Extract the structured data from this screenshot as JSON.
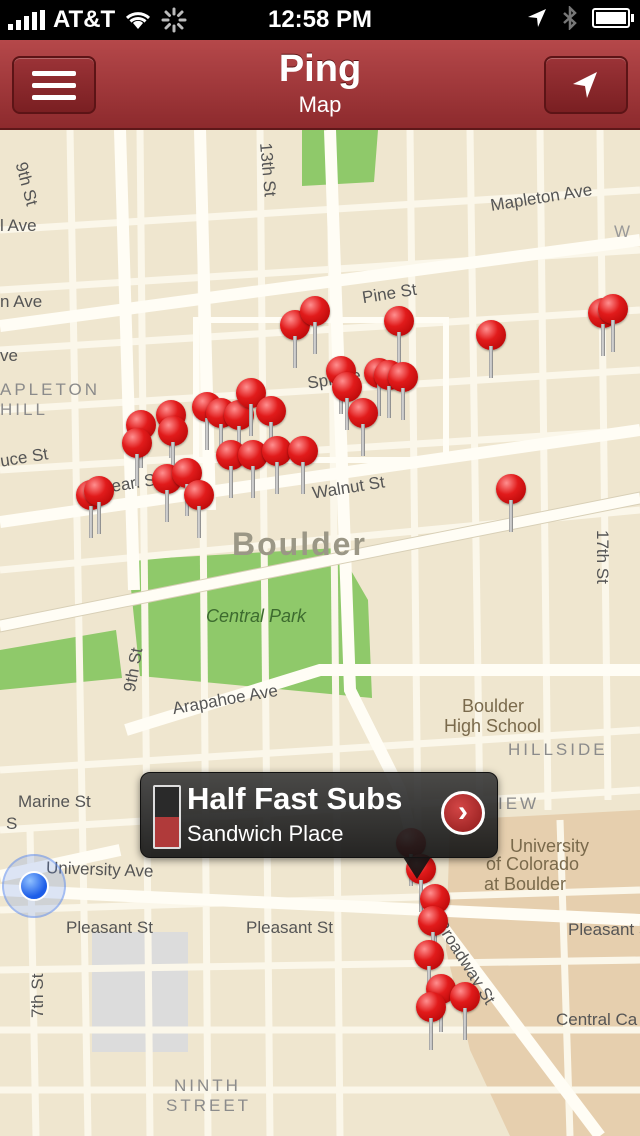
{
  "status": {
    "carrier": "AT&T",
    "time": "12:58 PM"
  },
  "nav": {
    "title": "Ping",
    "subtitle": "Map"
  },
  "map": {
    "streets": {
      "s9th_top": "9th St",
      "s13th": "13th St",
      "mapleton": "Mapleton Ave",
      "ave_left": "l Ave",
      "n_ave": "n Ave",
      "ave_left2": "ve",
      "pine": "Pine St",
      "spruce": "Spruce St",
      "spruce_left": "uce St",
      "pearl": "Pearl St",
      "walnut": "Walnut St",
      "s17th": "17th St",
      "s9th_mid": "9th St",
      "arapahoe": "Arapahoe Ave",
      "marine": "Marine St",
      "university": "University Ave",
      "pleasant1": "Pleasant St",
      "pleasant2": "Pleasant St",
      "pleasant3": "Pleasant St",
      "s7th": "7th St",
      "broadway": "Broadway St",
      "central_campus": "Central Ca",
      "w": "W",
      "s": "S"
    },
    "areas": {
      "boulder": "Boulder",
      "mapleton_hill_1": "APLETON",
      "mapleton_hill_2": "HILL",
      "central_park": "Central Park",
      "school_1": "Boulder",
      "school_2": "High School",
      "hillside": "HILLSIDE",
      "view": "IEW",
      "cu_1": "University",
      "cu_2": "of Colorado",
      "cu_3": "at Boulder",
      "ninth_1": "NINTH",
      "ninth_2": "STREET"
    }
  },
  "callout": {
    "title": "Half Fast Subs",
    "subtitle": "Sandwich Place",
    "gauge_level": 0.5
  },
  "colors": {
    "navbar": "#9b3337",
    "pin": "#e11b1b",
    "map_bg": "#efe6cf",
    "park": "#8fc96a"
  },
  "icons": {
    "menu": "hamburger-icon",
    "locate": "location-arrow-icon",
    "disclosure": "chevron-right-icon"
  }
}
